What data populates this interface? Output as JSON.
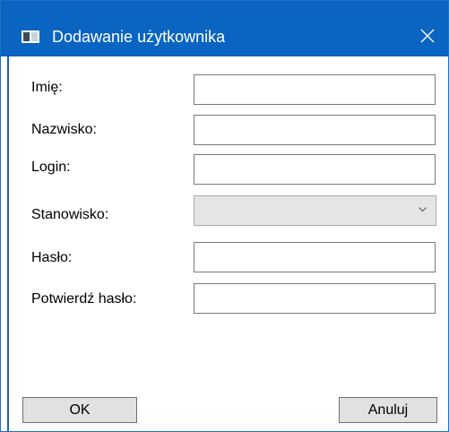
{
  "window": {
    "title": "Dodawanie użytkownika",
    "accent_color": "#0a64c2"
  },
  "form": {
    "first_name_label": "Imię:",
    "first_name_value": "",
    "last_name_label": "Nazwisko:",
    "last_name_value": "",
    "login_label": "Login:",
    "login_value": "",
    "position_label": "Stanowisko:",
    "position_value": "",
    "password_label": "Hasło:",
    "password_value": "",
    "confirm_password_label": "Potwierdź hasło:",
    "confirm_password_value": ""
  },
  "buttons": {
    "ok_label": "OK",
    "cancel_label": "Anuluj"
  },
  "icons": {
    "app": "window-icon",
    "close": "close-icon",
    "dropdown": "chevron-down-icon"
  }
}
